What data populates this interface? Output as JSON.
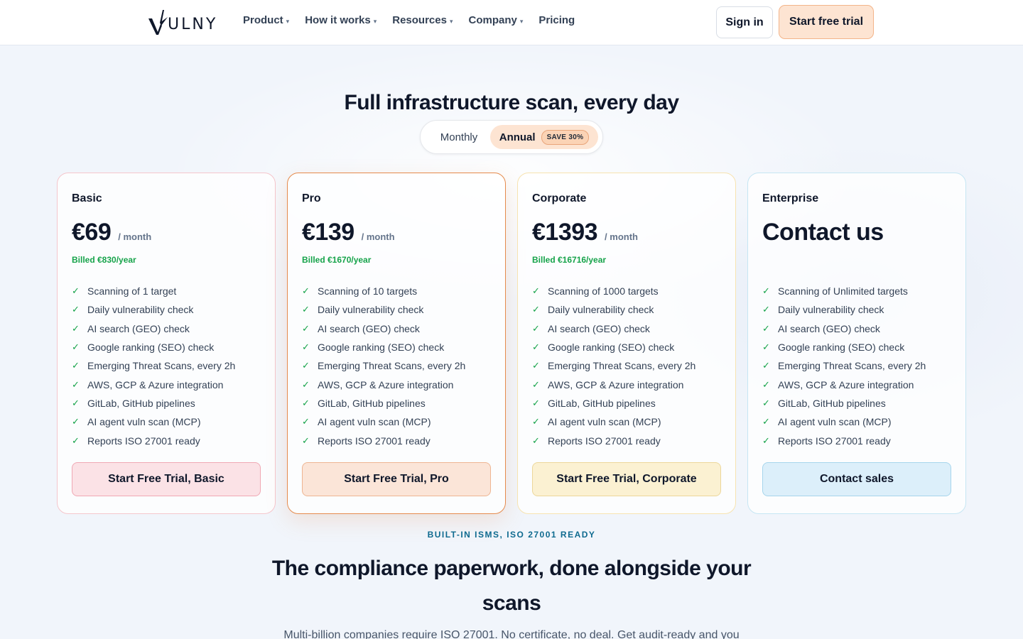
{
  "nav": {
    "logo_text": "ULNY",
    "menu": [
      {
        "label": "Product",
        "has_caret": true
      },
      {
        "label": "How it works",
        "has_caret": true
      },
      {
        "label": "Resources",
        "has_caret": true
      },
      {
        "label": "Company",
        "has_caret": true
      },
      {
        "label": "Pricing",
        "has_caret": false
      }
    ],
    "caret_glyph": "▾",
    "sign_in": "Sign in",
    "start_trial": "Start free trial"
  },
  "pricing": {
    "title": "Full infrastructure scan, every day",
    "toggle": {
      "monthly": "Monthly",
      "annual": "Annual",
      "badge": "SAVE 30%",
      "selected": "annual"
    },
    "check_glyph": "✓",
    "plans": [
      {
        "name": "Basic",
        "price": "€69",
        "per": "/ month",
        "billed": "Billed €830/year",
        "features": [
          "Scanning of 1 target",
          "Daily vulnerability check",
          "AI search (GEO) check",
          "Google ranking (SEO) check",
          "Emerging Threat Scans, every 2h",
          "AWS, GCP & Azure integration",
          "GitLab, GitHub pipelines",
          "AI agent vuln scan (MCP)",
          "Reports ISO 27001 ready"
        ],
        "cta": "Start Free Trial, Basic"
      },
      {
        "name": "Pro",
        "price": "€139",
        "per": "/ month",
        "billed": "Billed €1670/year",
        "features": [
          "Scanning of 10 targets",
          "Daily vulnerability check",
          "AI search (GEO) check",
          "Google ranking (SEO) check",
          "Emerging Threat Scans, every 2h",
          "AWS, GCP & Azure integration",
          "GitLab, GitHub pipelines",
          "AI agent vuln scan (MCP)",
          "Reports ISO 27001 ready"
        ],
        "cta": "Start Free Trial, Pro"
      },
      {
        "name": "Corporate",
        "price": "€1393",
        "per": "/ month",
        "billed": "Billed €16716/year",
        "features": [
          "Scanning of 1000 targets",
          "Daily vulnerability check",
          "AI search (GEO) check",
          "Google ranking (SEO) check",
          "Emerging Threat Scans, every 2h",
          "AWS, GCP & Azure integration",
          "GitLab, GitHub pipelines",
          "AI agent vuln scan (MCP)",
          "Reports ISO 27001 ready"
        ],
        "cta": "Start Free Trial, Corporate"
      },
      {
        "name": "Enterprise",
        "price": "Contact us",
        "per": "",
        "billed": "",
        "features": [
          "Scanning of Unlimited targets",
          "Daily vulnerability check",
          "AI search (GEO) check",
          "Google ranking (SEO) check",
          "Emerging Threat Scans, every 2h",
          "AWS, GCP & Azure integration",
          "GitLab, GitHub pipelines",
          "AI agent vuln scan (MCP)",
          "Reports ISO 27001 ready"
        ],
        "cta": "Contact sales"
      }
    ]
  },
  "compliance": {
    "eyebrow": "BUILT-IN ISMS, ISO 27001 READY",
    "title": "The compliance paperwork, done alongside your scans",
    "subtitle": "Multi-billion companies require ISO 27001. No certificate, no deal. Get audit-ready and you"
  },
  "colors": {
    "accent_orange": "#e58a4c",
    "check_green": "#16a34a",
    "eyebrow_teal": "#0e6a8f",
    "basic_tint": "#fbe2e6",
    "pro_tint": "#fbe5d8",
    "corporate_tint": "#fbf1d2",
    "enterprise_tint": "#dceffa"
  }
}
